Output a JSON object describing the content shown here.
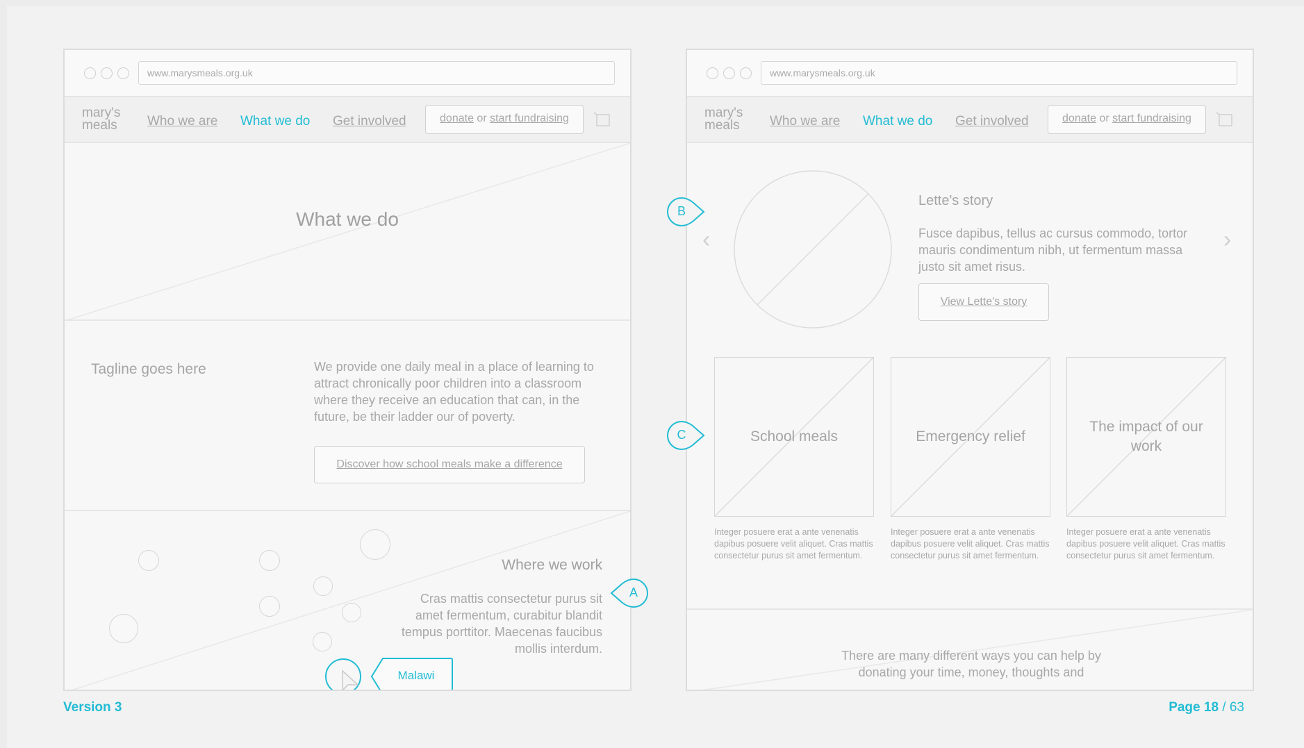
{
  "url": "www.marysmeals.org.uk",
  "logo": "mary's meals",
  "nav": {
    "who_we_are": "Who we are",
    "what_we_do": "What we do",
    "get_involved": "Get involved",
    "donate_link": "donate",
    "donate_or": "or",
    "fundraising_link": "start fundraising"
  },
  "left": {
    "hero_title": "What we do",
    "tagline": "Tagline goes here",
    "intro": "We provide one daily meal in a place of learning to attract chronically poor children into a classroom where they receive an education that can, in the future, be their ladder our of poverty.",
    "discover_button": "Discover how school meals make a difference",
    "where_title": "Where we work",
    "where_text": "Cras mattis consectetur purus sit amet fermentum, curabitur blandit tempus porttitor. Maecenas faucibus mollis interdum.",
    "malawi": "Malawi"
  },
  "right": {
    "story_title": "Lette's story",
    "story_text": "Fusce dapibus, tellus ac cursus commodo, tortor mauris condimentum nibh, ut fermentum massa justo sit amet risus.",
    "story_button": "View Lette's story",
    "cards": [
      {
        "title": "School meals",
        "text": "Integer posuere erat a ante venenatis dapibus posuere velit aliquet. Cras mattis consectetur purus sit amet fermentum."
      },
      {
        "title": "Emergency relief",
        "text": "Integer posuere erat a ante venenatis dapibus posuere velit aliquet. Cras mattis consectetur purus sit amet fermentum."
      },
      {
        "title": "The impact of our work",
        "text": "Integer posuere erat a ante venenatis dapibus posuere velit aliquet. Cras mattis consectetur purus sit amet fermentum."
      }
    ],
    "help_text": "There are many different ways you can help by donating your time, money, thoughts and"
  },
  "annotations": {
    "a": "A",
    "b": "B",
    "c": "C"
  },
  "footer": {
    "version": "Version 3",
    "page_label": "Page 18",
    "page_total": "/ 63"
  },
  "colors": {
    "accent": "#22bcd4",
    "wire_gray": "#a8a8a8"
  }
}
